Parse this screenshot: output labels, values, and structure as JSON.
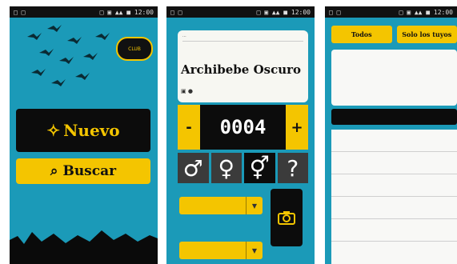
{
  "phones": [
    {
      "status": {
        "left": "□ □",
        "right": "□ ▣ ▲▲ ■ 12:00"
      },
      "badge_text": "CLUB",
      "new_button": "Nuevo",
      "search_button": "Buscar"
    },
    {
      "status": {
        "left": "□ □",
        "right": "□ ▣ ▲▲ ■ 12:00"
      },
      "breadcrumb": "...",
      "species": "Archibebe Oscuro",
      "date_time": "▣ ●",
      "counter_value": "0004",
      "minus": "-",
      "plus": "+",
      "sexes": [
        "♂",
        "♀",
        "⚥",
        "?"
      ],
      "dropdown1_label": "",
      "dropdown1_value": "",
      "dropdown2_label": "",
      "dropdown2_value": ""
    },
    {
      "status": {
        "left": "□ □",
        "right": "□ ▣ ▲▲ ■ 12:00"
      },
      "tabs": [
        "Todos",
        "Solo los tuyos"
      ],
      "card_r1": "",
      "card_r2": "",
      "card_r3": "",
      "card_r4": "",
      "section_bar": "",
      "list": [
        {
          "title": "",
          "sub": ""
        },
        {
          "title": "",
          "sub": ""
        },
        {
          "title": "",
          "sub": ""
        },
        {
          "title": "",
          "sub": ""
        },
        {
          "title": "",
          "sub": ""
        }
      ]
    }
  ],
  "colors": {
    "accent": "#f4c500",
    "bg": "#1b9ab8",
    "dark": "#0c0c0c"
  }
}
